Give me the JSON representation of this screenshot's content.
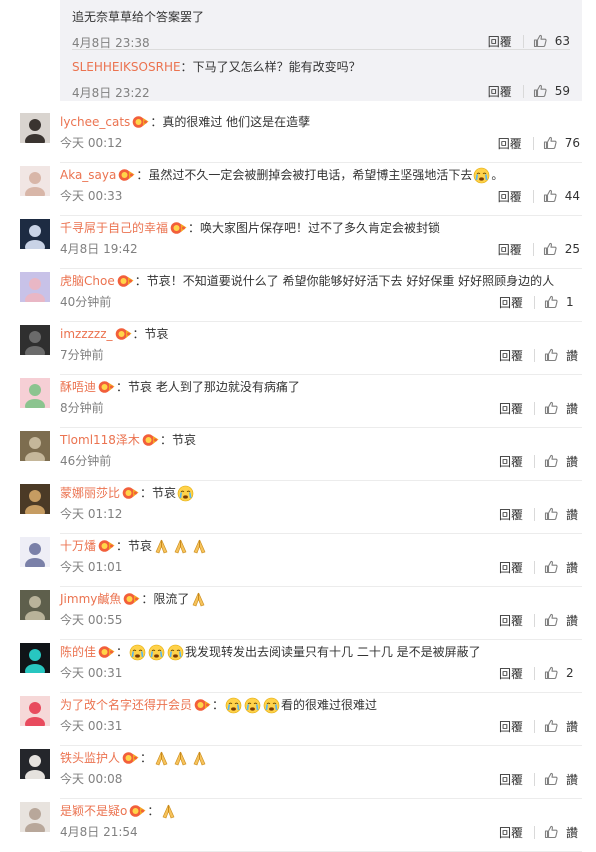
{
  "colors": {
    "username": "#eb7350",
    "text": "#333333",
    "meta": "#808080",
    "nested_bg": "#f2f2f5"
  },
  "icons": {
    "like": "thumbs-up-icon",
    "badge": "vip-badge-icon",
    "cry": "crying-face-emoji",
    "pray": "praying-hands-emoji"
  },
  "nested_replies": [
    {
      "username": "",
      "separator": "",
      "text": "追无奈草草给个答案罢了",
      "time": "4月8日 23:38",
      "reply_label": "回覆",
      "likes": "63"
    },
    {
      "username": "SLEHHEIKSOSRHE",
      "separator": "：",
      "text": "下马了又怎么样？能有改变吗？",
      "time": "4月8日 23:22",
      "reply_label": "回覆",
      "likes": "59"
    }
  ],
  "comments": [
    {
      "username": "lychee_cats",
      "separator": "：",
      "text": "真的很难过 他们这是在造孽",
      "time": "今天 00:12",
      "reply_label": "回覆",
      "likes": "76"
    },
    {
      "username": "Aka_saya",
      "separator": "：",
      "text": "虽然过不久一定会被删掉会被打电话，希望博主坚强地活下去",
      "trail": "。",
      "time": "今天 00:33",
      "reply_label": "回覆",
      "likes": "44"
    },
    {
      "username": "千寻屌于自己的幸福",
      "separator": "：",
      "text": "唤大家图片保存吧！过不了多久肯定会被封锁",
      "time": "4月8日 19:42",
      "reply_label": "回覆",
      "likes": "25"
    },
    {
      "username": "虎脑Choe",
      "separator": "：",
      "text": "节哀！不知道要说什么了 希望你能够好好活下去 好好保重 好好照顾身边的人",
      "time": "40分钟前",
      "reply_label": "回覆",
      "likes": "1"
    },
    {
      "username": "imzzzzz_",
      "separator": "：",
      "text": "节哀",
      "time": "7分钟前",
      "reply_label": "回覆",
      "likes": "讚"
    },
    {
      "username": "酥唔迪",
      "separator": "：",
      "text": "节哀 老人到了那边就没有病痛了",
      "time": "8分钟前",
      "reply_label": "回覆",
      "likes": "讚"
    },
    {
      "username": "Tloml118泽木",
      "separator": "：",
      "text": "节哀",
      "time": "46分钟前",
      "reply_label": "回覆",
      "likes": "讚"
    },
    {
      "username": "蒙娜丽莎比",
      "separator": "：",
      "text": "节哀",
      "time": "今天 01:12",
      "reply_label": "回覆",
      "likes": "讚"
    },
    {
      "username": "十万燔",
      "separator": "：",
      "text": "节哀",
      "time": "今天 01:01",
      "reply_label": "回覆",
      "likes": "讚"
    },
    {
      "username": "Jimmy鹹魚",
      "separator": "：",
      "text": "限流了",
      "time": "今天 00:55",
      "reply_label": "回覆",
      "likes": "讚"
    },
    {
      "username": "陈的佳",
      "separator": "：",
      "text": "我发现转发出去阅读量只有十几 二十几 是不是被屏蔽了",
      "time": "今天 00:31",
      "reply_label": "回覆",
      "likes": "2"
    },
    {
      "username": "为了改个名字还得开会员",
      "separator": "：",
      "text": "看的很难过很难过",
      "time": "今天 00:31",
      "reply_label": "回覆",
      "likes": "讚"
    },
    {
      "username": "铁头监护人",
      "separator": "：",
      "text": "",
      "time": "今天 00:08",
      "reply_label": "回覆",
      "likes": "讚"
    },
    {
      "username": "是颖不是疑o",
      "separator": "：",
      "text": "",
      "time": "4月8日 21:54",
      "reply_label": "回覆",
      "likes": "讚"
    }
  ]
}
